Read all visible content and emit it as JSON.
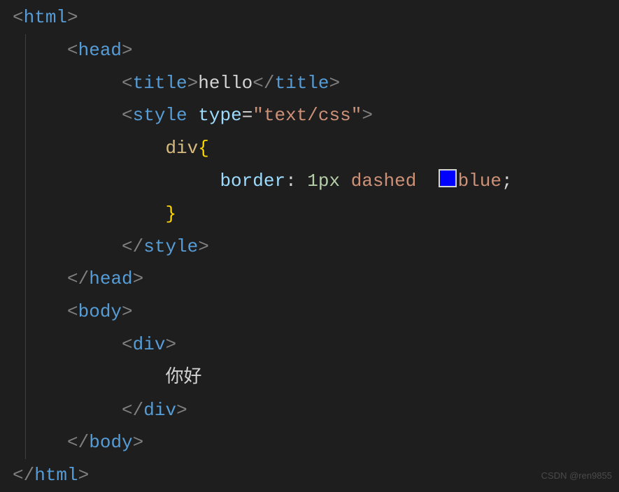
{
  "code": {
    "tag_html": "html",
    "tag_head": "head",
    "tag_title": "title",
    "title_text": "hello",
    "tag_style": "style",
    "attr_type": "type",
    "attr_type_val": "\"text/css\"",
    "selector_div": "div",
    "curly_open": "{",
    "curly_close": "}",
    "prop_border": "border",
    "colon": ":",
    "val_1px": "1px",
    "val_dashed": "dashed",
    "val_blue": "blue",
    "semicolon": ";",
    "tag_body": "body",
    "tag_div": "div",
    "div_text": "你好",
    "eq": "="
  },
  "color_swatch": "#0000ff",
  "watermark": "CSDN @ren9855"
}
